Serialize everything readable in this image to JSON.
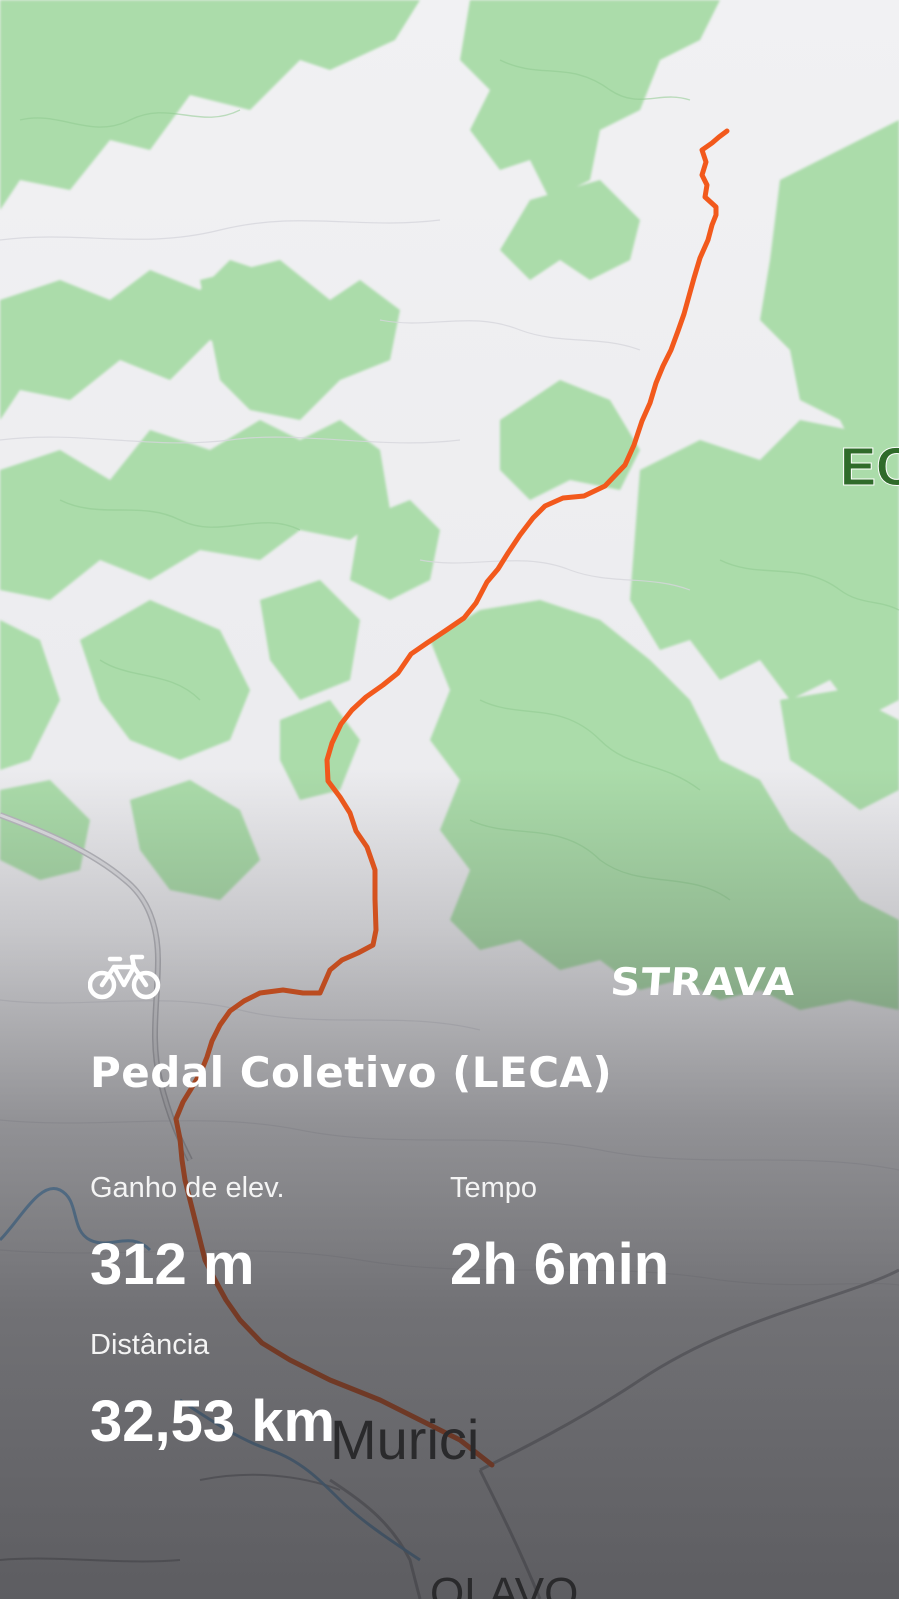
{
  "map": {
    "labels": {
      "ec": "EC",
      "murici": "Murici",
      "olavo": "OLAVO"
    },
    "colors": {
      "forest": "#a9dba8",
      "forest_dark": "#93cf94",
      "terrain": "#f4f4f6",
      "route": "#f2591c",
      "road": "#b7b7bd",
      "river": "#6aa6d8"
    }
  },
  "activity": {
    "type_icon": "bike-icon",
    "brand": "STRAVA",
    "title": "Pedal Coletivo (LECA)",
    "stats": {
      "elevation_label": "Ganho de elev.",
      "elevation_value": "312 m",
      "time_label": "Tempo",
      "time_value": "2h 6min",
      "distance_label": "Distância",
      "distance_value": "32,53 km"
    }
  }
}
